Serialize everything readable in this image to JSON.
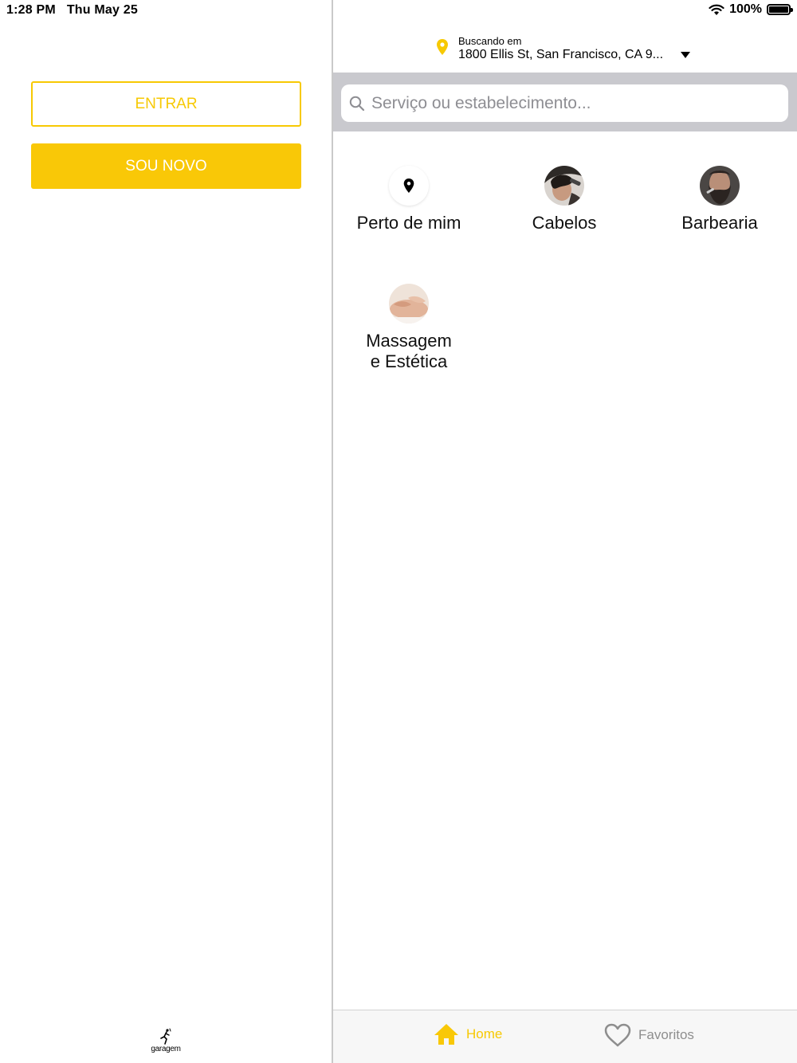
{
  "status_bar": {
    "time": "1:28 PM",
    "date": "Thu May 25",
    "battery": "100%"
  },
  "left": {
    "login_label": "ENTRAR",
    "signup_label": "SOU NOVO",
    "logo_text": "garagem"
  },
  "location": {
    "label": "Buscando em",
    "address": "1800 Ellis St, San Francisco, CA 9..."
  },
  "search": {
    "placeholder": "Serviço ou estabelecimento..."
  },
  "categories": [
    {
      "label": "Perto de mim",
      "icon": "location-pin-icon"
    },
    {
      "label": "Cabelos",
      "icon": "haircut-photo"
    },
    {
      "label": "Barbearia",
      "icon": "beard-photo"
    },
    {
      "label": "Massagem e Estética",
      "icon": "massage-photo"
    }
  ],
  "tabs": [
    {
      "label": "Home",
      "icon": "home-icon",
      "active": true
    },
    {
      "label": "Favoritos",
      "icon": "heart-icon",
      "active": false
    }
  ],
  "colors": {
    "accent": "#f9c807",
    "search_strip": "#c9c9ce",
    "inactive_tab": "#8e8e8e"
  }
}
